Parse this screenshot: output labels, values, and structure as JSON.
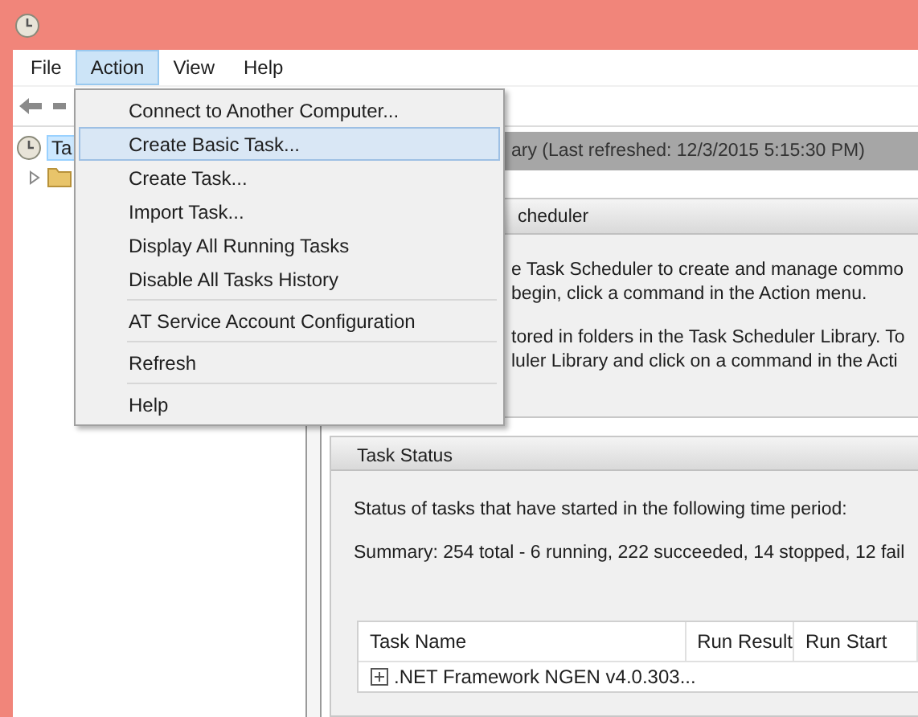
{
  "menu_bar": [
    {
      "label": "File",
      "selected": false
    },
    {
      "label": "Action",
      "selected": true
    },
    {
      "label": "View",
      "selected": false
    },
    {
      "label": "Help",
      "selected": false
    }
  ],
  "action_menu": {
    "groups": [
      [
        {
          "label": "Connect to Another Computer...",
          "selected": false
        },
        {
          "label": "Create Basic Task...",
          "selected": true
        },
        {
          "label": "Create Task...",
          "selected": false
        },
        {
          "label": "Import Task...",
          "selected": false
        },
        {
          "label": "Display All Running Tasks",
          "selected": false
        },
        {
          "label": "Disable All Tasks History",
          "selected": false
        }
      ],
      [
        {
          "label": "AT Service Account Configuration",
          "selected": false
        }
      ],
      [
        {
          "label": "Refresh",
          "selected": false
        }
      ],
      [
        {
          "label": "Help",
          "selected": false
        }
      ]
    ]
  },
  "tree": [
    {
      "label": "Ta",
      "selected": true,
      "children": [
        {
          "expanded": false
        }
      ]
    }
  ],
  "header_bar": {
    "title": "ary (Last refreshed: 12/3/2015 5:15:30 PM)"
  },
  "overview_section": {
    "title": "cheduler",
    "paragraphs": [
      [
        "e Task Scheduler to create and manage commo",
        "begin, click a command in the Action menu."
      ],
      [
        "tored in folders in the Task Scheduler Library. To",
        "luler Library and click on a command in the Acti"
      ]
    ]
  },
  "task_status_section": {
    "title": "Task Status",
    "description": "Status of tasks that have started in the following time period:",
    "summary": "Summary: 254 total - 6 running, 222 succeeded, 14 stopped, 12 fail",
    "table": {
      "columns": [
        "Task Name",
        "Run Result",
        "Run Start"
      ],
      "rows": [
        {
          "task_name": ".NET Framework NGEN v4.0.303..."
        }
      ]
    }
  }
}
